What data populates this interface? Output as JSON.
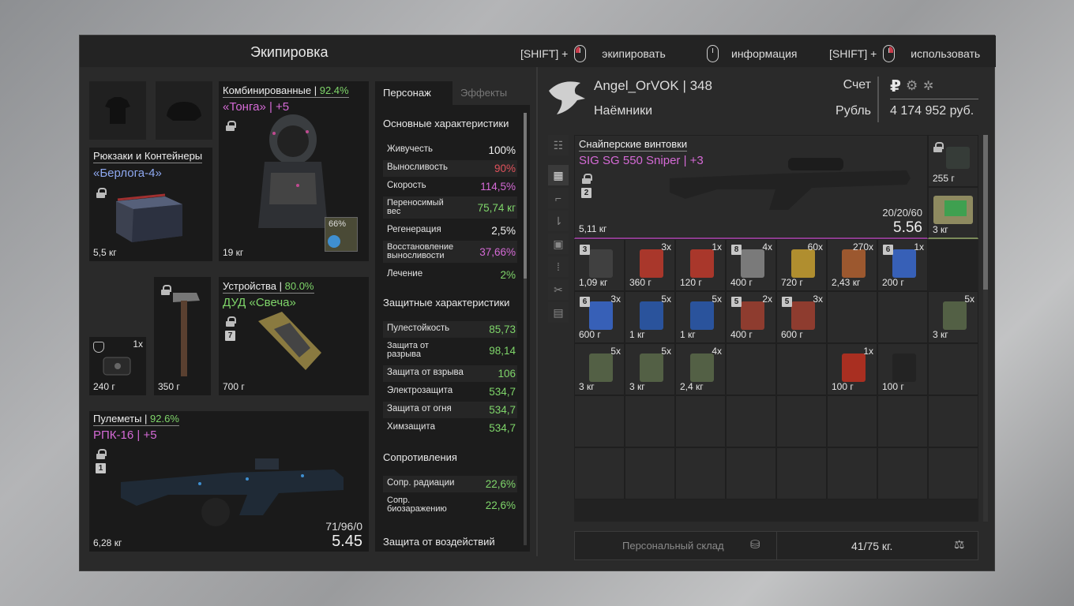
{
  "title": "Экипировка",
  "hints": [
    {
      "prefix": "[SHIFT] +",
      "label": "экипировать",
      "icon": "mouse-left-icon"
    },
    {
      "prefix": "",
      "label": "информация",
      "icon": "mouse-icon"
    },
    {
      "prefix": "[SHIFT] +",
      "label": "использовать",
      "icon": "mouse-right-icon"
    }
  ],
  "equipment": {
    "backpack": {
      "category": "Рюкзаки и Контейнеры",
      "name": "«Берлога-4»",
      "weight": "5,5 кг"
    },
    "armor": {
      "category": "Комбинированные",
      "pct": "92.4%",
      "name": "«Тонга»",
      "upgrade": "+5",
      "weight": "19 кг",
      "battery": "66%"
    },
    "grenade": {
      "qty": "1x",
      "weight": "240 г"
    },
    "hammer": {
      "weight": "350 г"
    },
    "device": {
      "category": "Устройства",
      "pct": "80.0%",
      "name": "ДУД «Свеча»",
      "badge": "7",
      "weight": "700 г"
    },
    "weapon": {
      "category": "Пулеметы",
      "pct": "92.6%",
      "name": "РПК-16",
      "upgrade": "+5",
      "badge": "1",
      "weight": "6,28 кг",
      "ammo": "71/96/0",
      "caliber": "5.45"
    }
  },
  "stats": {
    "tabs": [
      "Персонаж",
      "Эффекты"
    ],
    "main_title": "Основные характеристики",
    "main": [
      {
        "k": "Живучесть",
        "v": "100%",
        "c": "w"
      },
      {
        "k": "Выносливость",
        "v": "90%",
        "c": "r"
      },
      {
        "k": "Скорость",
        "v": "114,5%",
        "c": "p"
      },
      {
        "k": "Переносимый вес",
        "v": "75,74 кг",
        "c": "g"
      },
      {
        "k": "Регенерация",
        "v": "2,5%",
        "c": "w"
      },
      {
        "k": "Восстановление выносливости",
        "v": "37,66%",
        "c": "p"
      },
      {
        "k": "Лечение",
        "v": "2%",
        "c": "g"
      }
    ],
    "prot_title": "Защитные характеристики",
    "prot": [
      {
        "k": "Пулестойкость",
        "v": "85,73"
      },
      {
        "k": "Защита от разрыва",
        "v": "98,14"
      },
      {
        "k": "Защита от взрыва",
        "v": "106"
      },
      {
        "k": "Электрозащита",
        "v": "534,7"
      },
      {
        "k": "Защита от огня",
        "v": "534,7"
      },
      {
        "k": "Химзащита",
        "v": "534,7"
      }
    ],
    "res_title": "Сопротивления",
    "res": [
      {
        "k": "Сопр. радиации",
        "v": "22,6%"
      },
      {
        "k": "Сопр. биозаражению",
        "v": "22,6%"
      }
    ],
    "eff_title": "Защита от воздействий"
  },
  "profile": {
    "name": "Angel_OrVOK | 348",
    "faction": "Наёмники",
    "account_label": "Счет",
    "currency_label": "Рубль",
    "balance": "4 174 952 руб."
  },
  "featured": {
    "category": "Снайперские винтовки",
    "name": "SIG SG 550 Sniper | +3",
    "badge": "2",
    "weight": "5,11 кг",
    "ammo": "20/20/60",
    "caliber": "5.56"
  },
  "items": [
    {
      "w": "1,09 кг",
      "q": "",
      "b": "3"
    },
    {
      "w": "360 г",
      "q": "3x",
      "b": ""
    },
    {
      "w": "120 г",
      "q": "1x",
      "b": ""
    },
    {
      "w": "400 г",
      "q": "4x",
      "b": "8"
    },
    {
      "w": "720 г",
      "q": "60x",
      "b": ""
    },
    {
      "w": "2,43 кг",
      "q": "270x",
      "b": ""
    },
    {
      "w": "200 г",
      "q": "1x",
      "b": "6"
    },
    {
      "w": "600 г",
      "q": "3x",
      "b": "6"
    },
    {
      "w": "1 кг",
      "q": "5x",
      "b": ""
    },
    {
      "w": "1 кг",
      "q": "5x",
      "b": ""
    },
    {
      "w": "400 г",
      "q": "2x",
      "b": "5"
    },
    {
      "w": "600 г",
      "q": "3x",
      "b": "5"
    },
    {
      "w": "3 кг",
      "q": "5x",
      "b": ""
    },
    {
      "w": "3 кг",
      "q": "5x",
      "b": ""
    },
    {
      "w": "3 кг",
      "q": "5x",
      "b": ""
    },
    {
      "w": "2,4 кг",
      "q": "4x",
      "b": ""
    },
    {
      "w": "100 г",
      "q": "1x",
      "b": ""
    },
    {
      "w": "100 г",
      "q": "",
      "b": ""
    }
  ],
  "right_col": [
    {
      "w": "255 г"
    },
    {
      "w": "3 кг"
    }
  ],
  "footer": {
    "storage": "Персональный склад",
    "weight": "41/75 кг."
  },
  "colors": {
    "accent_purple": "#d56ad6",
    "accent_green": "#7fd66a",
    "accent_red": "#e0525c",
    "accent_blue": "#8ea8f0"
  }
}
